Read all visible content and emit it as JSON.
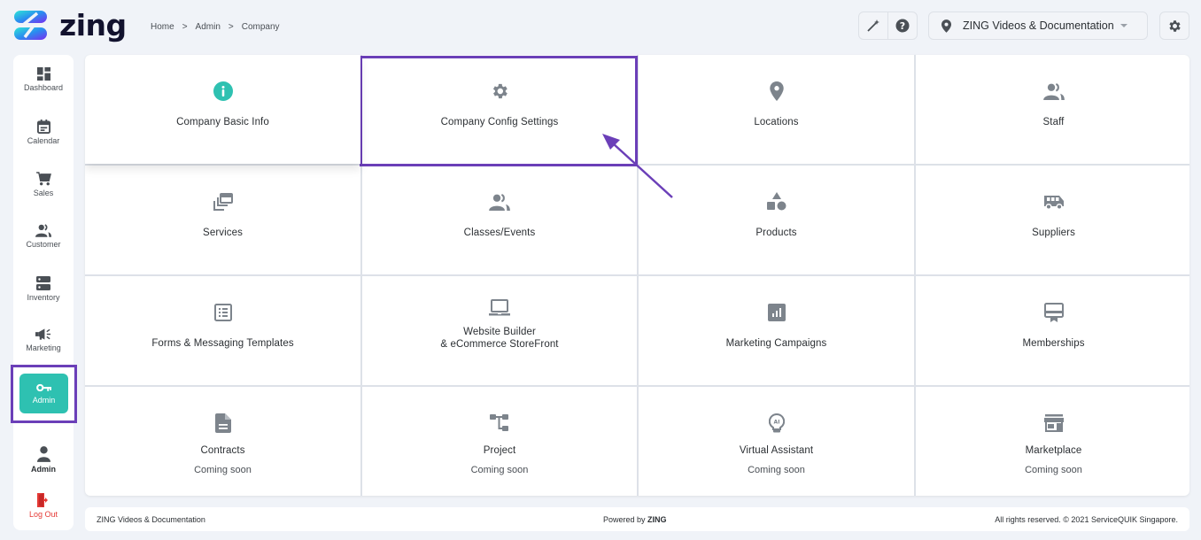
{
  "app": {
    "logo_text": "zing"
  },
  "breadcrumb": {
    "items": [
      "Home",
      "Admin",
      "Company"
    ],
    "separator": ">"
  },
  "header": {
    "tools": [
      {
        "icon": "magic-wand-icon"
      },
      {
        "icon": "help-icon"
      }
    ],
    "location_selector": {
      "icon": "location-pin-icon",
      "value": "ZING Videos & Documentation"
    },
    "settings_icon": "gear-icon"
  },
  "sidebar": {
    "items": [
      {
        "label": "Dashboard",
        "icon": "dashboard-icon"
      },
      {
        "label": "Calendar",
        "icon": "calendar-icon"
      },
      {
        "label": "Sales",
        "icon": "cart-icon"
      },
      {
        "label": "Customer",
        "icon": "people-icon"
      },
      {
        "label": "Inventory",
        "icon": "storage-icon"
      },
      {
        "label": "Marketing",
        "icon": "megaphone-icon"
      },
      {
        "label": "Admin",
        "icon": "key-icon",
        "active": true
      }
    ],
    "profile": {
      "label": "Admin",
      "icon": "user-icon"
    },
    "logout": {
      "label": "Log Out",
      "icon": "logout-icon"
    }
  },
  "cards": [
    {
      "title": "Company Basic Info",
      "icon": "info-icon"
    },
    {
      "title": "Company Config Settings",
      "icon": "gear-icon",
      "highlighted": true
    },
    {
      "title": "Locations",
      "icon": "location-pin-icon"
    },
    {
      "title": "Staff",
      "icon": "people-icon"
    },
    {
      "title": "Services",
      "icon": "layers-icon"
    },
    {
      "title": "Classes/Events",
      "icon": "people-icon"
    },
    {
      "title": "Products",
      "icon": "shapes-icon"
    },
    {
      "title": "Suppliers",
      "icon": "van-icon"
    },
    {
      "title": "Forms & Messaging Templates",
      "icon": "list-form-icon"
    },
    {
      "title": "Website Builder\n& eCommerce StoreFront",
      "icon": "laptop-icon"
    },
    {
      "title": "Marketing Campaigns",
      "icon": "bar-chart-icon"
    },
    {
      "title": "Memberships",
      "icon": "card-membership-icon"
    },
    {
      "title": "Contracts",
      "subtitle": "Coming soon",
      "icon": "document-icon"
    },
    {
      "title": "Project",
      "subtitle": "Coming soon",
      "icon": "tree-icon"
    },
    {
      "title": "Virtual Assistant",
      "subtitle": "Coming soon",
      "icon": "ai-bulb-icon"
    },
    {
      "title": "Marketplace",
      "subtitle": "Coming soon",
      "icon": "store-icon"
    }
  ],
  "footer": {
    "left": "ZING Videos & Documentation",
    "center_prefix": "Powered by",
    "center_brand": "ZING",
    "right": "All rights reserved. © 2021 ServiceQUIK Singapore."
  },
  "colors": {
    "accent": "#2ec1b1",
    "annotation": "#6b3fb8",
    "icon_gray": "#7d848c",
    "logout_red": "#e53935"
  }
}
